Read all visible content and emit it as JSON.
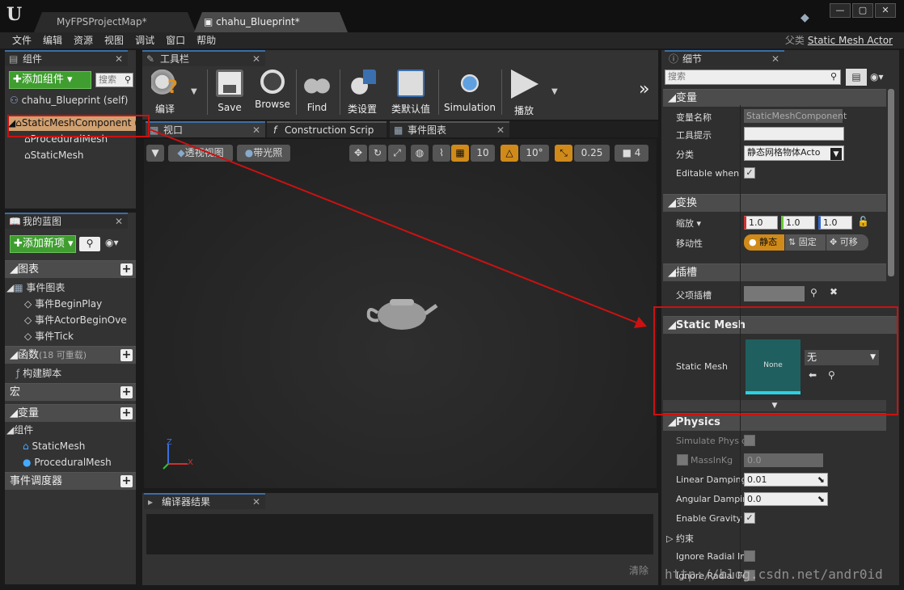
{
  "window": {
    "tabs": [
      "MyFPSProjectMap*",
      "chahu_Blueprint*"
    ],
    "controls": [
      "—",
      "▢",
      "✕"
    ]
  },
  "menu": [
    "文件",
    "编辑",
    "资源",
    "视图",
    "调试",
    "窗口",
    "帮助"
  ],
  "parent_class": {
    "label": "父类",
    "value": "Static Mesh Actor"
  },
  "components": {
    "tab": "组件",
    "add_button": "添加组件",
    "search_placeholder": "搜索",
    "self_item": "chahu_Blueprint (self)",
    "items": [
      "StaticMeshComponent (",
      "ProceduralMesh",
      "StaticMesh"
    ]
  },
  "my_blueprint": {
    "tab": "我的蓝图",
    "add_button": "添加新项",
    "sections": {
      "graphs": "图表",
      "event_graph": "事件图表",
      "events": [
        "事件BeginPlay",
        "事件ActorBeginOve",
        "事件Tick"
      ],
      "functions": "函数",
      "functions_note": "(18 可重载)",
      "construct": "构建脚本",
      "macros": "宏",
      "variables": "变量",
      "components": "组件",
      "vars": [
        "StaticMesh",
        "ProceduralMesh"
      ],
      "dispatchers": "事件调度器"
    }
  },
  "toolbar": {
    "tab": "工具栏",
    "buttons": [
      "编译",
      "Save",
      "Browse",
      "Find",
      "类设置",
      "类默认值",
      "Simulation",
      "播放"
    ],
    "overflow": "»"
  },
  "editor_tabs": [
    "视口",
    "Construction Scrip",
    "事件图表"
  ],
  "viewport": {
    "perspective": "透视视图",
    "lit": "带光照",
    "grid_snap": "10",
    "rot_snap": "10°",
    "scale_snap": "0.25",
    "cam_speed": "4",
    "axis_x": "X",
    "axis_z": "Z"
  },
  "compiler": {
    "tab": "编译器结果",
    "clear": "清除"
  },
  "details": {
    "tab": "细节",
    "search_placeholder": "搜索",
    "sections": {
      "variable": "变量",
      "transform": "变换",
      "sockets": "插槽",
      "static_mesh": "Static Mesh",
      "physics": "Physics"
    },
    "variable": {
      "name_label": "变量名称",
      "name_value": "StaticMeshComponent",
      "tooltip_label": "工具提示",
      "category_label": "分类",
      "category_value": "静态网格物体Acto",
      "editable_label": "Editable when Ir"
    },
    "transform": {
      "scale_label": "缩放",
      "scale": [
        "1.0",
        "1.0",
        "1.0"
      ],
      "mobility_label": "移动性",
      "mobility": [
        "静态",
        "固定",
        "可移"
      ]
    },
    "sockets": {
      "parent_label": "父项插槽"
    },
    "static_mesh": {
      "label": "Static Mesh",
      "thumb": "None",
      "value": "无"
    },
    "physics": {
      "simulate": "Simulate Physic",
      "mass": "MassInKg",
      "mass_value": "0.0",
      "linear": "Linear Damping",
      "linear_value": "0.01",
      "angular": "Angular Dampin",
      "angular_value": "0.0",
      "gravity": "Enable Gravity",
      "constraints": "约束",
      "ignore1": "Ignore Radial Im",
      "ignore2": "Ignore Radial Fo"
    }
  },
  "watermark": "http://blog.csdn.net/andr0id",
  "colors": {
    "highlight": "#cc1111",
    "accent": "#3c6ea6",
    "green": "#3f9e2f",
    "orange": "#d08a1a"
  }
}
